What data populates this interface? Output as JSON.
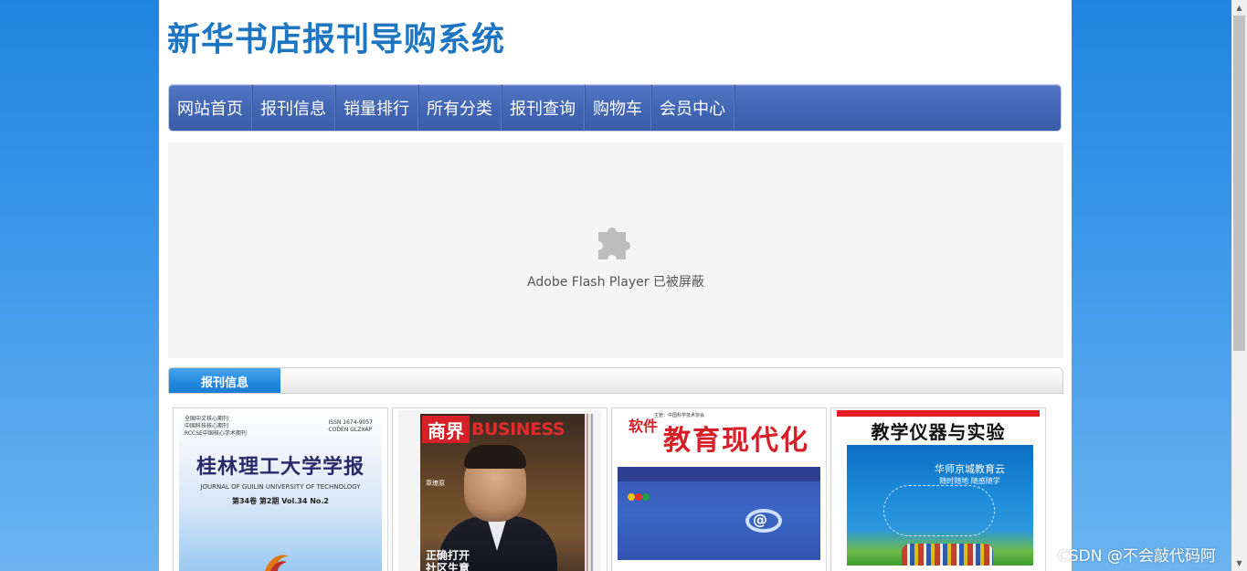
{
  "site": {
    "title": "新华书店报刊导购系统"
  },
  "nav": {
    "items": [
      {
        "label": "网站首页"
      },
      {
        "label": "报刊信息"
      },
      {
        "label": "销量排行"
      },
      {
        "label": "所有分类"
      },
      {
        "label": "报刊查询"
      },
      {
        "label": "购物车"
      },
      {
        "label": "会员中心"
      }
    ]
  },
  "flash": {
    "icon": "puzzle-icon",
    "message": "Adobe Flash Player 已被屏蔽"
  },
  "section": {
    "tab_label": "报刊信息"
  },
  "books": [
    {
      "cover": {
        "masthead": [
          "全国中文核心期刊",
          "中国科技核心期刊",
          "RCCSE中国核心学术期刊"
        ],
        "issn": [
          "ISSN 1674-9057",
          "CODEN GLZXAP"
        ],
        "title": "桂林理工大学学报",
        "subtitle": "JOURNAL OF GUILIN UNIVERSITY OF TECHNOLOGY",
        "volume": "第34卷  第2期  Vol.34  No.2"
      }
    },
    {
      "cover": {
        "masthead": "商界",
        "brand": "BUSINESS",
        "person": "章燎原",
        "bottom_lines": [
          "正确打开",
          "社区生意"
        ]
      }
    },
    {
      "cover": {
        "prefix": "软件",
        "title": "教育现代化",
        "publisher": "主管：中国科学技术协会"
      }
    },
    {
      "cover": {
        "title": "教学仪器与实验",
        "headline": [
          "华师京城教育云",
          "随时随地  随感随学"
        ]
      }
    }
  ],
  "watermark": "CSDN @不会敲代码阿",
  "colors": {
    "title": "#1e76c2",
    "nav_bg": "#4366b4",
    "tab_active": "#2287de",
    "page_bg": "#1f84e0"
  }
}
